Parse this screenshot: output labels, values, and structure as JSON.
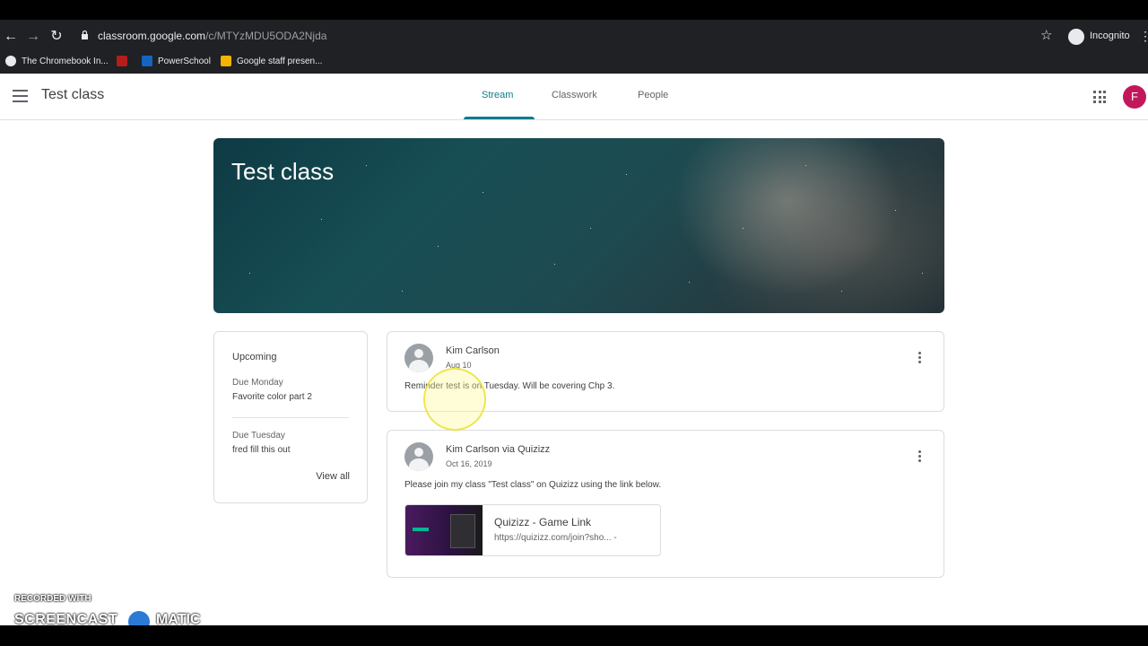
{
  "browser": {
    "url_host": "classroom.google.com",
    "url_path": "/c/MTYzMDU5ODA2Njda",
    "incognito_label": "Incognito",
    "bookmarks": [
      {
        "label": "The Chromebook In...",
        "color": "#e8eaed"
      },
      {
        "label": "",
        "color": "#b71c1c"
      },
      {
        "label": "PowerSchool",
        "color": "#1565c0"
      },
      {
        "label": "Google staff presen...",
        "color": "#f4b400"
      }
    ]
  },
  "header": {
    "class_title": "Test class",
    "tabs": [
      {
        "label": "Stream",
        "active": true
      },
      {
        "label": "Classwork",
        "active": false
      },
      {
        "label": "People",
        "active": false
      }
    ],
    "avatar_letter": "F"
  },
  "banner": {
    "title": "Test class"
  },
  "upcoming": {
    "title": "Upcoming",
    "items": [
      {
        "due": "Due Monday",
        "name": "Favorite color part 2"
      },
      {
        "due": "Due Tuesday",
        "name": "fred fill this out"
      }
    ],
    "view_all": "View all"
  },
  "posts": [
    {
      "author": "Kim Carlson",
      "date": "Aug 10",
      "text": "Reminder test is on Tuesday.  Will be covering Chp 3."
    },
    {
      "author": "Kim Carlson via Quizizz",
      "date": "Oct 16, 2019",
      "text": "Please join my class \"Test class\" on Quizizz using the link below.",
      "attachment": {
        "title": "Quizizz - Game Link",
        "url": "https://quizizz.com/join?sho... -"
      }
    }
  ],
  "watermark": {
    "line1": "RECORDED WITH",
    "line2a": "SCREENCAST",
    "line2b": "MATIC"
  },
  "colors": {
    "accent": "#0f7c8c",
    "avatar": "#c2185b",
    "chrome": "#202124"
  }
}
